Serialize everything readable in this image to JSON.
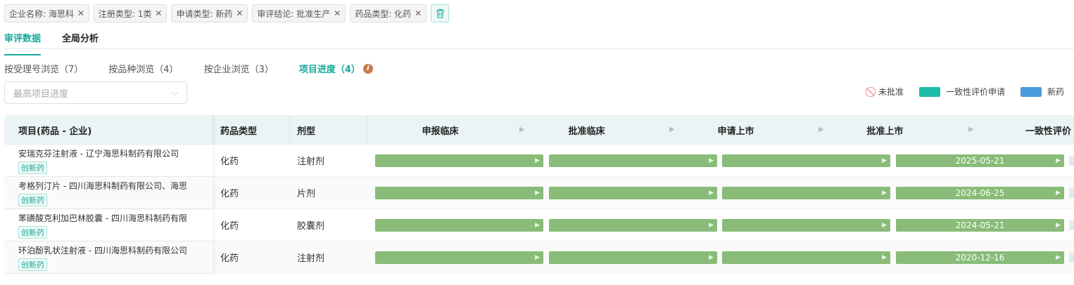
{
  "filters": [
    "企业名称: 海思科",
    "注册类型: 1类",
    "申请类型: 新药",
    "审评结论: 批准生产",
    "药品类型: 化药"
  ],
  "tabs": [
    "审评数据",
    "全局分析"
  ],
  "subtabs": [
    "按受理号浏览（7）",
    "按品种浏览（4）",
    "按企业浏览（3）",
    "项目进度（4）"
  ],
  "select_placeholder": "最高项目进度",
  "legend": [
    "未批准",
    "一致性评价申请",
    "新药"
  ],
  "colors": {
    "accent": "#18a99a",
    "bar": "#88bc78",
    "consistency": "#1fbcab",
    "new": "#4a9be0",
    "rejected": "#f05a5a"
  },
  "headers": [
    "项目(药品 - 企业)",
    "药品类型",
    "剂型"
  ],
  "stages": [
    "申报临床",
    "批准临床",
    "申请上市",
    "批准上市",
    "一致性评价"
  ],
  "rows": [
    {
      "name": "安瑞克芬注射液 - 辽宁海思科制药有限公司",
      "badge": "创新药",
      "type": "化药",
      "form": "注射剂",
      "date": "2025-05-21"
    },
    {
      "name": "考格列汀片 - 四川海思科制药有限公司、海思",
      "badge": "创新药",
      "type": "化药",
      "form": "片剂",
      "date": "2024-06-25"
    },
    {
      "name": "苯磺酸克利加巴林胶囊 - 四川海思科制药有限",
      "badge": "创新药",
      "type": "化药",
      "form": "胶囊剂",
      "date": "2024-05-21"
    },
    {
      "name": "环泊酚乳状注射液 - 四川海思科制药有限公司",
      "badge": "创新药",
      "type": "化药",
      "form": "注射剂",
      "date": "2020-12-16"
    }
  ]
}
